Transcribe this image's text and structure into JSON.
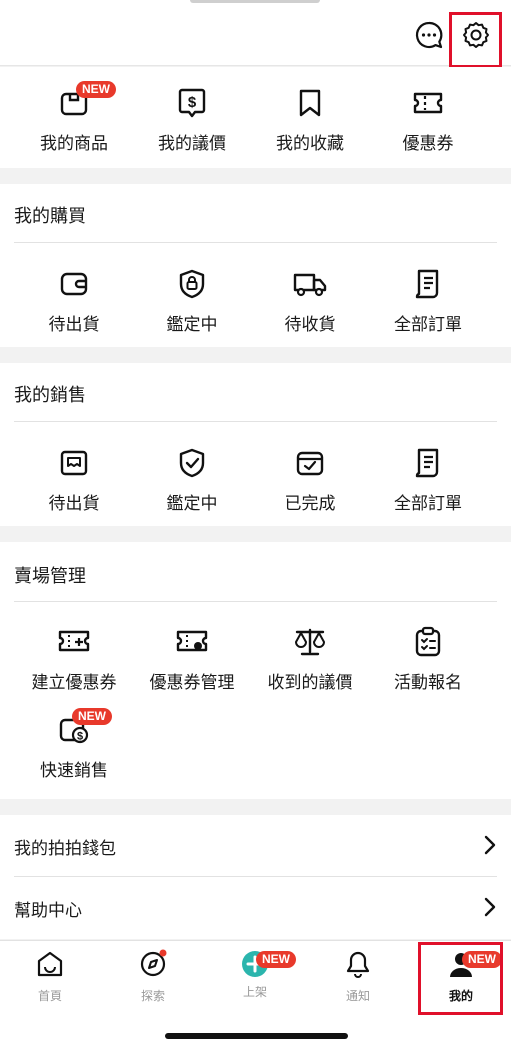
{
  "top": {
    "icons": [
      "chat-icon",
      "gear-icon"
    ]
  },
  "quick": {
    "items": [
      {
        "label": "我的商品",
        "badge": "NEW",
        "icon": "product-box-icon"
      },
      {
        "label": "我的議價",
        "icon": "dollar-bubble-icon"
      },
      {
        "label": "我的收藏",
        "icon": "bookmark-icon"
      },
      {
        "label": "優惠券",
        "icon": "coupon-icon"
      }
    ]
  },
  "purchases": {
    "title": "我的購買",
    "items": [
      {
        "label": "待出貨",
        "icon": "wallet-icon"
      },
      {
        "label": "鑑定中",
        "icon": "shield-lock-icon"
      },
      {
        "label": "待收貨",
        "icon": "truck-icon"
      },
      {
        "label": "全部訂單",
        "icon": "orders-list-icon"
      }
    ]
  },
  "sales": {
    "title": "我的銷售",
    "items": [
      {
        "label": "待出貨",
        "icon": "package-icon"
      },
      {
        "label": "鑑定中",
        "icon": "shield-check-icon"
      },
      {
        "label": "已完成",
        "icon": "box-check-icon"
      },
      {
        "label": "全部訂單",
        "icon": "orders-list-icon"
      }
    ]
  },
  "store": {
    "title": "賣場管理",
    "items": [
      {
        "label": "建立優惠券",
        "icon": "coupon-add-icon"
      },
      {
        "label": "優惠券管理",
        "icon": "coupon-manage-icon"
      },
      {
        "label": "收到的議價",
        "icon": "scale-icon"
      },
      {
        "label": "活動報名",
        "icon": "clipboard-icon"
      },
      {
        "label": "快速銷售",
        "badge": "NEW",
        "icon": "quick-sale-icon"
      }
    ]
  },
  "list": {
    "items": [
      {
        "label": "我的拍拍錢包"
      },
      {
        "label": "幫助中心"
      }
    ]
  },
  "tabbar": {
    "tabs": [
      {
        "label": "首頁",
        "icon": "home-icon"
      },
      {
        "label": "探索",
        "icon": "compass-icon"
      },
      {
        "label": "上架",
        "icon": "add-icon",
        "badge": "NEW"
      },
      {
        "label": "通知",
        "icon": "bell-icon"
      },
      {
        "label": "我的",
        "icon": "profile-icon",
        "badge": "NEW",
        "active": true
      }
    ]
  },
  "colors": {
    "accent": "#e8392b",
    "highlight": "#e0102a",
    "teal": "#2bb5ad"
  }
}
